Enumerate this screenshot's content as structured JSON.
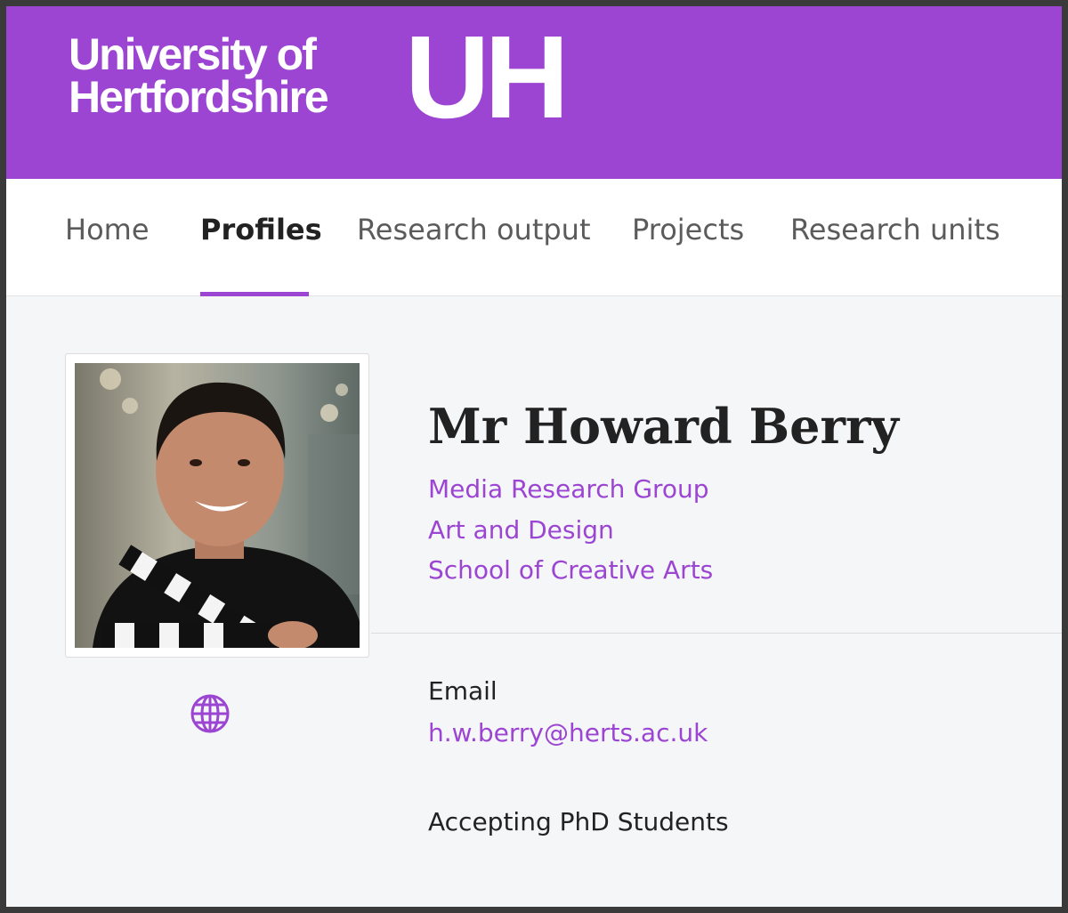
{
  "header": {
    "logo_line1": "University of",
    "logo_line2": "Hertfordshire",
    "logo_mark": "UH",
    "brand_color": "#9b45d2"
  },
  "nav": {
    "items": [
      {
        "label": "Home",
        "active": false
      },
      {
        "label": "Profiles",
        "active": true
      },
      {
        "label": "Research output",
        "active": false
      },
      {
        "label": "Projects",
        "active": false
      },
      {
        "label": "Research units",
        "active": false
      }
    ]
  },
  "profile": {
    "name": "Mr Howard Berry",
    "units": [
      "Media Research Group",
      "Art and Design",
      "School of Creative Arts"
    ],
    "website_icon": "globe-icon",
    "email_label": "Email",
    "email": "h.w.berry@herts.ac.uk",
    "status": "Accepting PhD Students"
  }
}
